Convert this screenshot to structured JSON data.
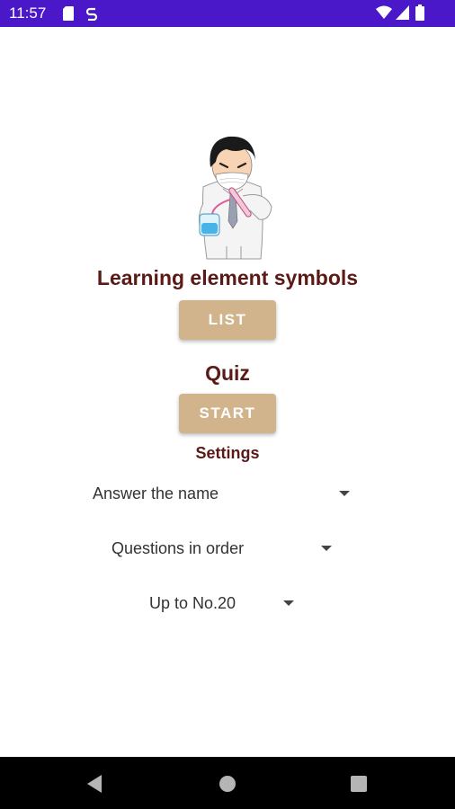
{
  "status_bar": {
    "time": "11:57",
    "left_icons": [
      "sd-card-icon",
      "sync-icon"
    ],
    "right_icons": [
      "wifi-icon",
      "signal-icon",
      "battery-icon"
    ],
    "color": "#4a17c9"
  },
  "main": {
    "illustration": "scientist-illustration",
    "learning_title": "Learning element symbols",
    "list_button": "LIST",
    "quiz_title": "Quiz",
    "start_button": "START",
    "settings_title": "Settings",
    "settings": [
      {
        "selected": "Answer the name"
      },
      {
        "selected": "Questions in order"
      },
      {
        "selected": "Up to No.20"
      }
    ],
    "colors": {
      "title": "#5b1a16",
      "button": "#d2b48c"
    }
  },
  "nav_bar": {
    "icons": [
      "back-icon",
      "home-icon",
      "recents-icon"
    ]
  }
}
